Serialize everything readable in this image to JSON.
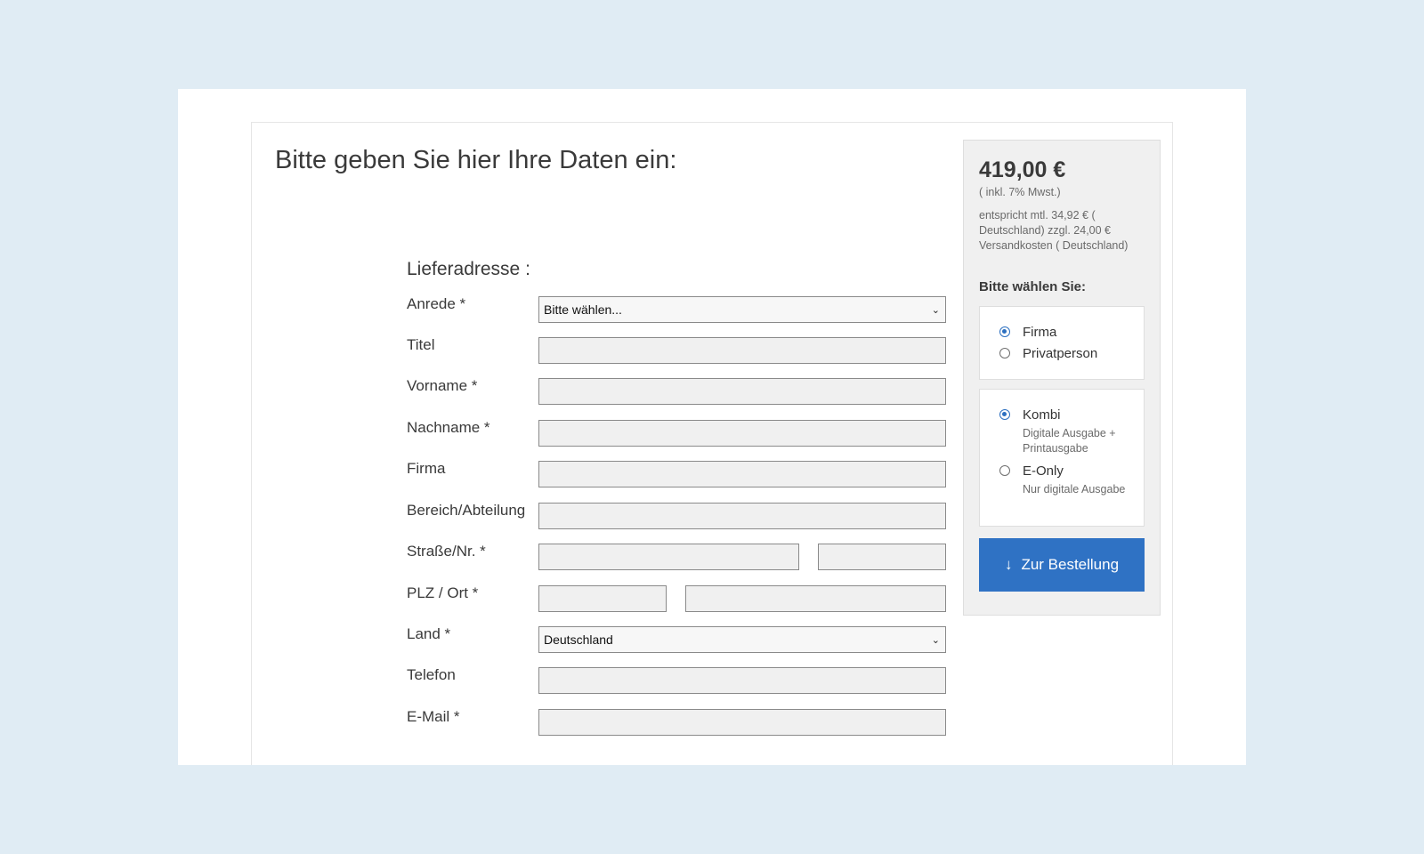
{
  "form": {
    "heading": "Bitte geben Sie hier Ihre Daten ein:",
    "section_title": "Lieferadresse :",
    "fields": {
      "anrede": {
        "label": "Anrede *",
        "value": "Bitte wählen..."
      },
      "titel": {
        "label": "Titel",
        "value": ""
      },
      "vorname": {
        "label": "Vorname *",
        "value": ""
      },
      "nachname": {
        "label": "Nachname *",
        "value": ""
      },
      "firma": {
        "label": "Firma",
        "value": ""
      },
      "abteilung": {
        "label": "Bereich/Abteilung",
        "value": ""
      },
      "strasse": {
        "label": "Straße/Nr. *",
        "street_value": "",
        "number_value": ""
      },
      "plz_ort": {
        "label": "PLZ / Ort *",
        "plz_value": "",
        "ort_value": ""
      },
      "land": {
        "label": "Land *",
        "value": "Deutschland"
      },
      "telefon": {
        "label": "Telefon",
        "value": ""
      },
      "email": {
        "label": "E-Mail *",
        "value": ""
      }
    }
  },
  "sidebar": {
    "price": "419,00 €",
    "tax_note": "( inkl. 7% Mwst.)",
    "monthly_note": "entspricht mtl. 34,92 € ( Deutschland) zzgl. 24,00 € Versandkosten ( Deutschland)",
    "choose_label": "Bitte wählen Sie:",
    "customer_type": [
      {
        "label": "Firma",
        "checked": true
      },
      {
        "label": "Privatperson",
        "checked": false
      }
    ],
    "editions": [
      {
        "label": "Kombi",
        "description": "Digitale Ausgabe + Printausgabe",
        "checked": true
      },
      {
        "label": "E-Only",
        "description": "Nur digitale Ausgabe",
        "checked": false
      }
    ],
    "order_button": {
      "icon": "arrow-down-icon",
      "label": "Zur Bestellung"
    }
  },
  "colors": {
    "background": "#e0ecf4",
    "accent": "#2f72c4",
    "sidebar_bg": "#f0f0f0",
    "input_bg": "#f0f0f0"
  }
}
